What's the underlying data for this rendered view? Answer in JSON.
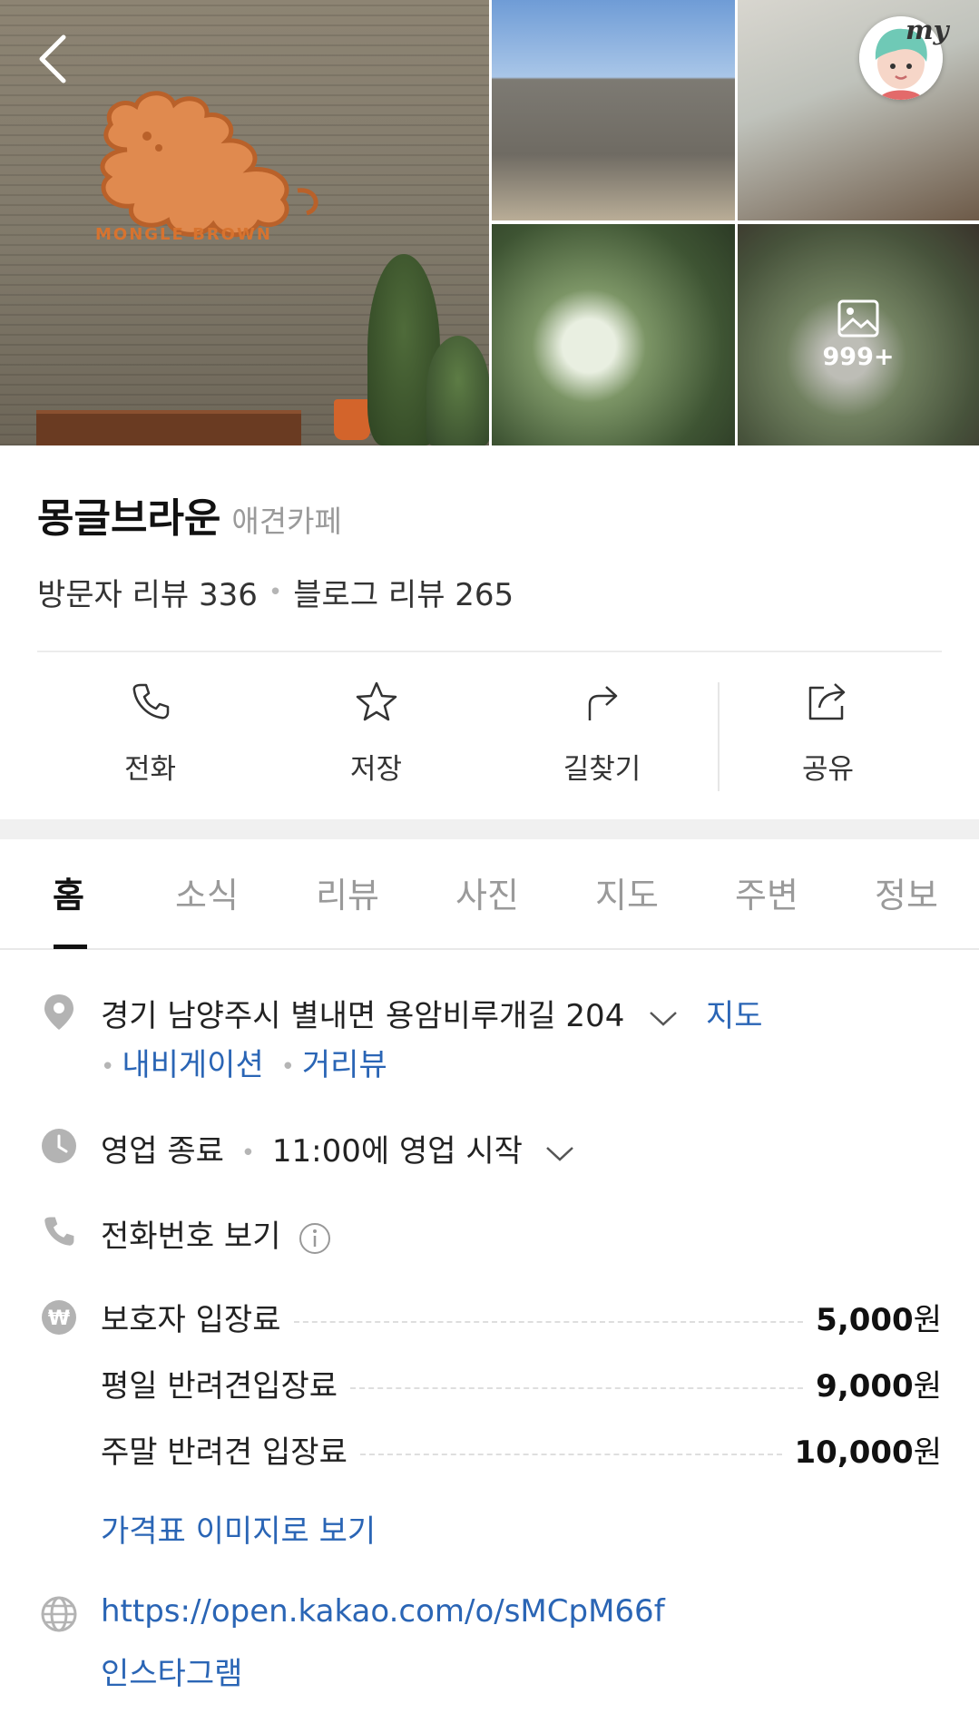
{
  "header": {
    "more_photos_count": "999+",
    "my_label": "my",
    "brand_sign": "MONGLE BROWN"
  },
  "place": {
    "name": "몽글브라운",
    "category": "애견카페",
    "visitor_reviews": "방문자 리뷰 336",
    "blog_reviews": "블로그 리뷰 265"
  },
  "actions": [
    {
      "label": "전화",
      "icon": "phone-icon"
    },
    {
      "label": "저장",
      "icon": "star-icon"
    },
    {
      "label": "길찾기",
      "icon": "directions-icon"
    },
    {
      "label": "공유",
      "icon": "share-icon"
    }
  ],
  "tabs": [
    {
      "label": "홈",
      "active": true
    },
    {
      "label": "소식"
    },
    {
      "label": "리뷰"
    },
    {
      "label": "사진"
    },
    {
      "label": "지도"
    },
    {
      "label": "주변"
    },
    {
      "label": "정보"
    }
  ],
  "info": {
    "address": "경기 남양주시 별내면 용암비루개길 204",
    "map_link": "지도",
    "navigation_link": "내비게이션",
    "roadview_link": "거리뷰",
    "hours_status": "영업 종료",
    "hours_next": "11:00에 영업 시작",
    "phone_label": "전화번호 보기",
    "prices": [
      {
        "label": "보호자 입장료",
        "amount": "5,000",
        "unit": "원"
      },
      {
        "label": "평일 반려견입장료",
        "amount": "9,000",
        "unit": "원"
      },
      {
        "label": "주말 반려견 입장료",
        "amount": "10,000",
        "unit": "원"
      }
    ],
    "price_image_link": "가격표 이미지로 보기",
    "website": "https://open.kakao.com/o/sMCpM66f",
    "instagram": "인스타그램"
  },
  "colors": {
    "link": "#2a65b5",
    "icon_grey": "#b0b0b0",
    "brand_orange": "#d7732f"
  }
}
